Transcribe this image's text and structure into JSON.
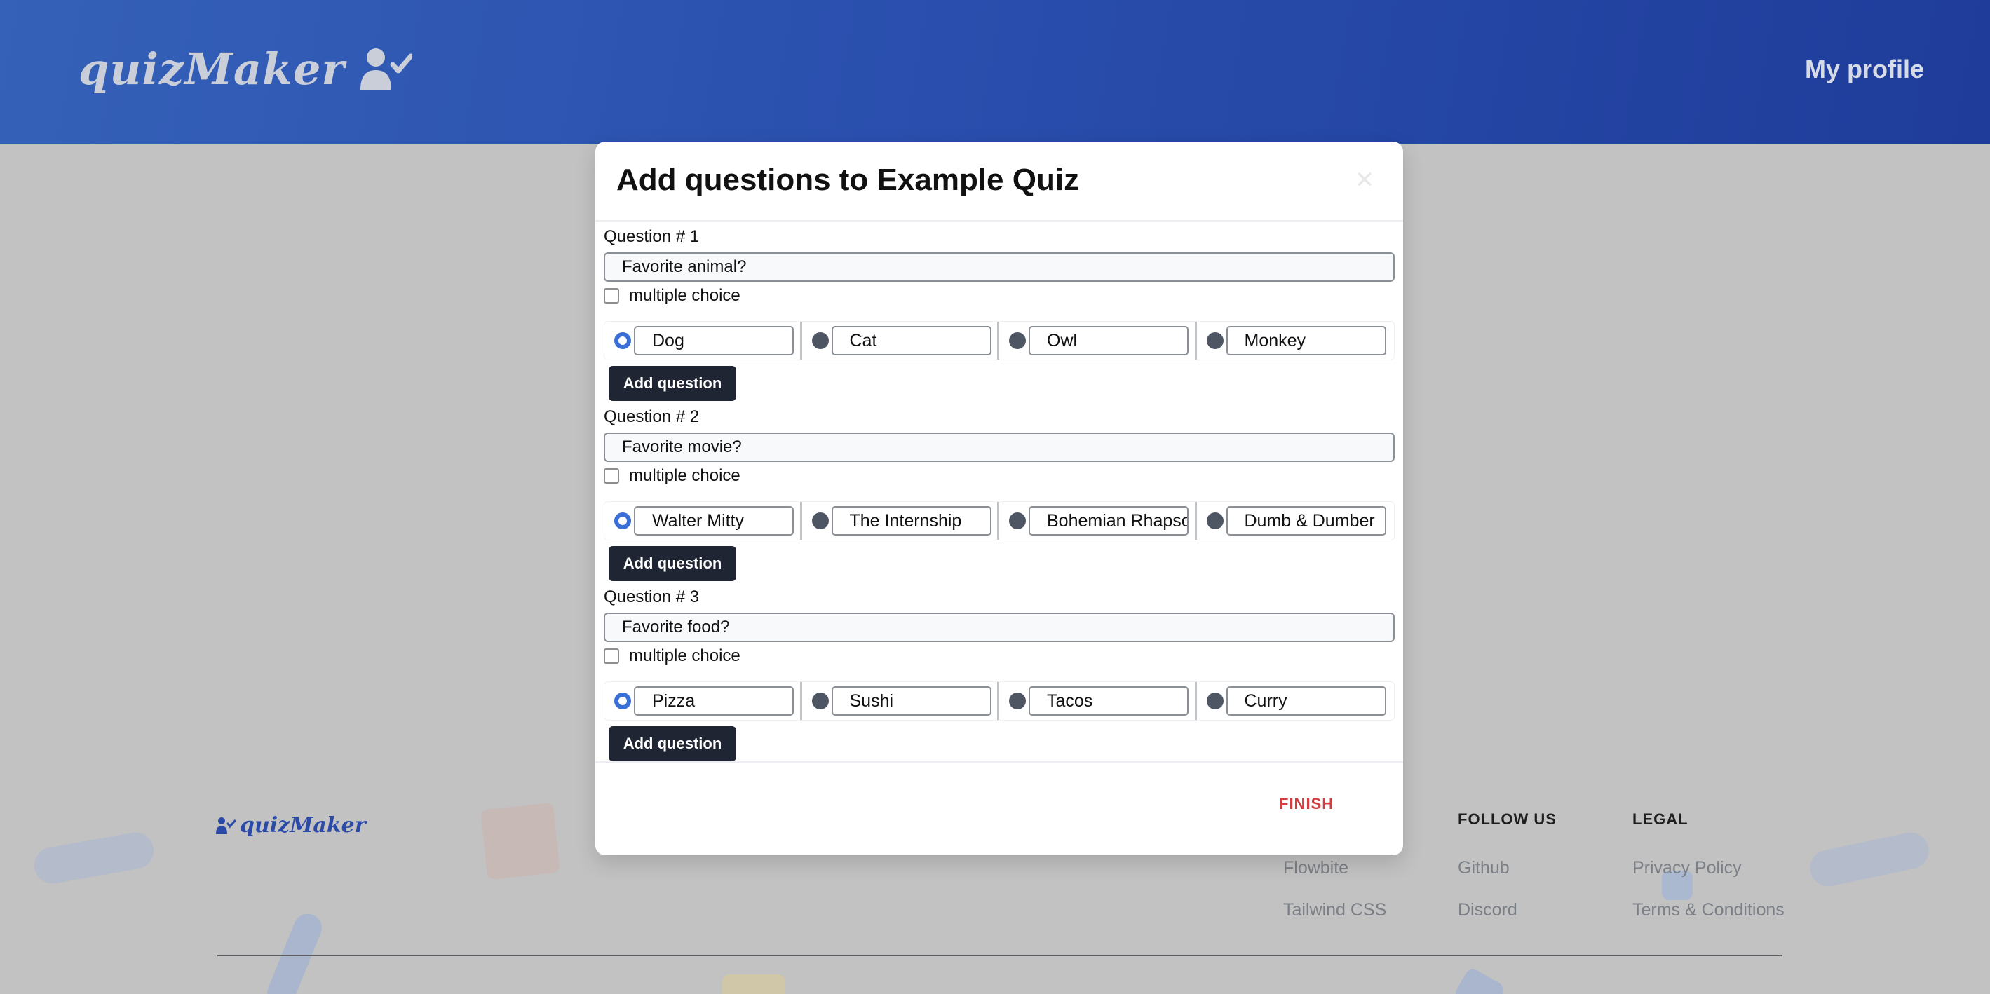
{
  "header": {
    "logo_text": "quizMaker",
    "logo_icon": "user-check-icon",
    "profile_link": "My profile"
  },
  "footer": {
    "logo_text": "quizMaker",
    "columns": [
      {
        "heading": "",
        "links": [
          "Flowbite",
          "Tailwind CSS"
        ]
      },
      {
        "heading": "FOLLOW US",
        "links": [
          "Github",
          "Discord"
        ]
      },
      {
        "heading": "LEGAL",
        "links": [
          "Privacy Policy",
          "Terms & Conditions"
        ]
      }
    ]
  },
  "modal": {
    "title": "Add questions to Example Quiz",
    "close_icon": "close-icon",
    "multiple_choice_label": "multiple choice",
    "add_question_label": "Add question",
    "finish_label": "FINISH",
    "questions": [
      {
        "label": "Question # 1",
        "text": "Favorite animal?",
        "answers": [
          "Dog",
          "Cat",
          "Owl",
          "Monkey"
        ],
        "correct_index": 0
      },
      {
        "label": "Question # 2",
        "text": "Favorite movie?",
        "answers": [
          "Walter Mitty",
          "The Internship",
          "Bohemian Rhapsody",
          "Dumb & Dumber"
        ],
        "correct_index": 0
      },
      {
        "label": "Question # 3",
        "text": "Favorite food?",
        "answers": [
          "Pizza",
          "Sushi",
          "Tacos",
          "Curry"
        ],
        "correct_index": 0
      }
    ]
  },
  "colors": {
    "header_gradient_start": "#3561b8",
    "header_gradient_end": "#1f3c9a",
    "overlay": "#c2c2c2",
    "button_dark": "#1f2533",
    "radio_selected": "#3b6fd8",
    "finish_red": "#d33d3d"
  }
}
